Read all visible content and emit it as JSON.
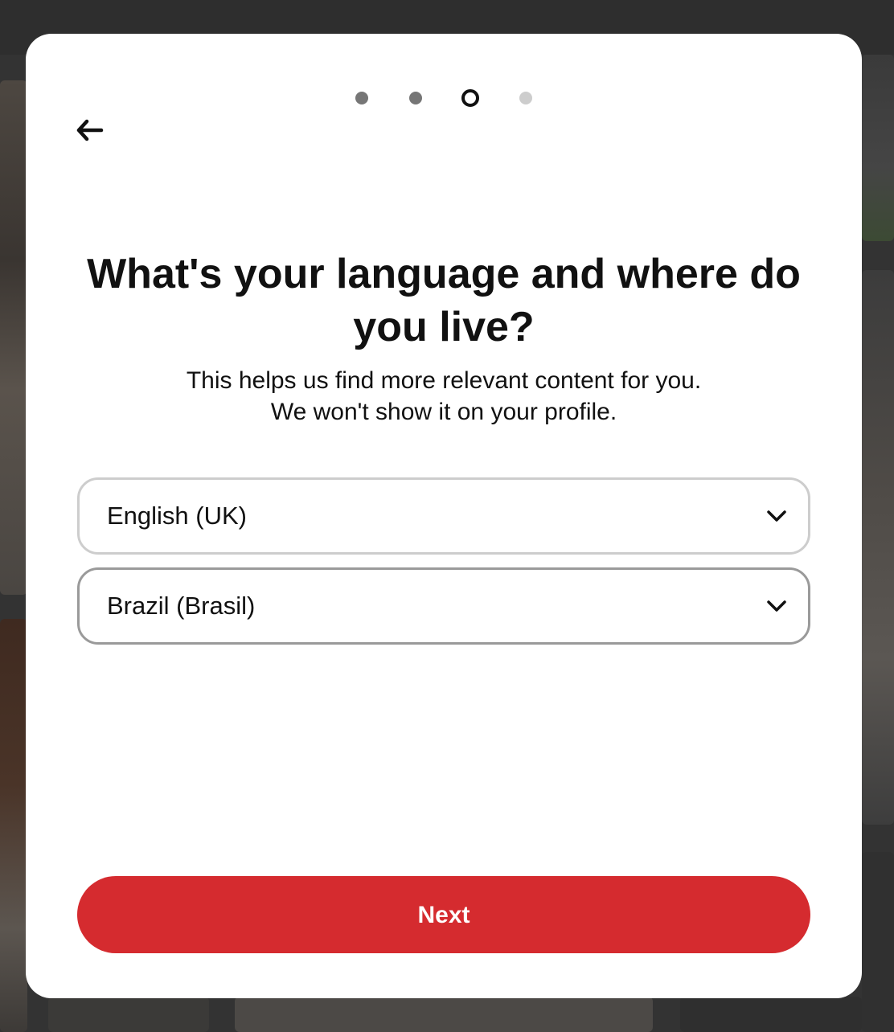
{
  "onboarding": {
    "steps_total": 4,
    "current_step": 3,
    "back_icon": "arrow-left-icon",
    "title": "What's your language and where do you live?",
    "subtitle": "This helps us find more relevant content for you. We won't show it on your profile.",
    "language_select": {
      "value": "English (UK)",
      "icon": "chevron-down-icon"
    },
    "country_select": {
      "value": "Brazil (Brasil)",
      "icon": "chevron-down-icon"
    },
    "next_label": "Next"
  },
  "colors": {
    "primary_button": "#d52b2f",
    "step_done": "#767676",
    "step_current_ring": "#111111",
    "step_todo": "#cdcdcd",
    "text": "#111111"
  }
}
